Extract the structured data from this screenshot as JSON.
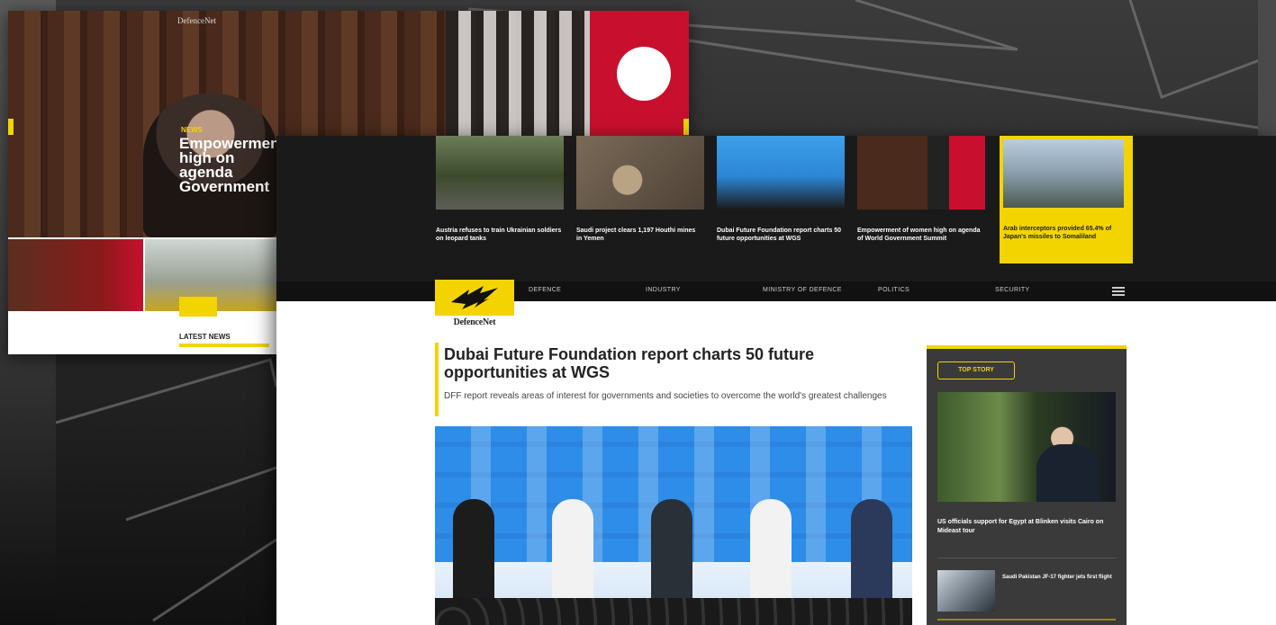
{
  "back_page": {
    "brand": "DefenceNet",
    "hero_kicker": "NEWS",
    "hero_headline": "Empowerment high on agenda Government",
    "hero_sub": "",
    "latest_news_label": "LATEST NEWS"
  },
  "top_strip": {
    "cards": [
      {
        "meta": "",
        "title": "Austria refuses to train Ukrainian soldiers on leopard tanks"
      },
      {
        "meta": "",
        "title": "Saudi project clears 1,197 Houthi mines in Yemen"
      },
      {
        "meta": "",
        "title": "Dubai Future Foundation report charts 50 future opportunities at WGS"
      },
      {
        "meta": "",
        "title": "Empowerment of women high on agenda of World Government Summit"
      },
      {
        "meta": "",
        "title": "Arab interceptors provided 65.4% of Japan's missiles to Somaliland"
      }
    ]
  },
  "nav": {
    "items": [
      "DEFENCE",
      "INDUSTRY",
      "MINISTRY OF DEFENCE",
      "POLITICS",
      "SECURITY"
    ]
  },
  "logo": {
    "text": "DefenceNet"
  },
  "article": {
    "title": "Dubai Future Foundation report charts 50 future opportunities at WGS",
    "subtitle": "DFF report reveals areas of interest for governments and societies to overcome the world's greatest challenges"
  },
  "sidebar": {
    "tag": "TOP STORY",
    "title": "US officials support for Egypt at Blinken visits Cairo on Mideast tour",
    "item2": "Saudi Pakistan JF-17 fighter jets first flight"
  },
  "colors": {
    "accent": "#f3d400",
    "dark": "#1a1a1a"
  }
}
